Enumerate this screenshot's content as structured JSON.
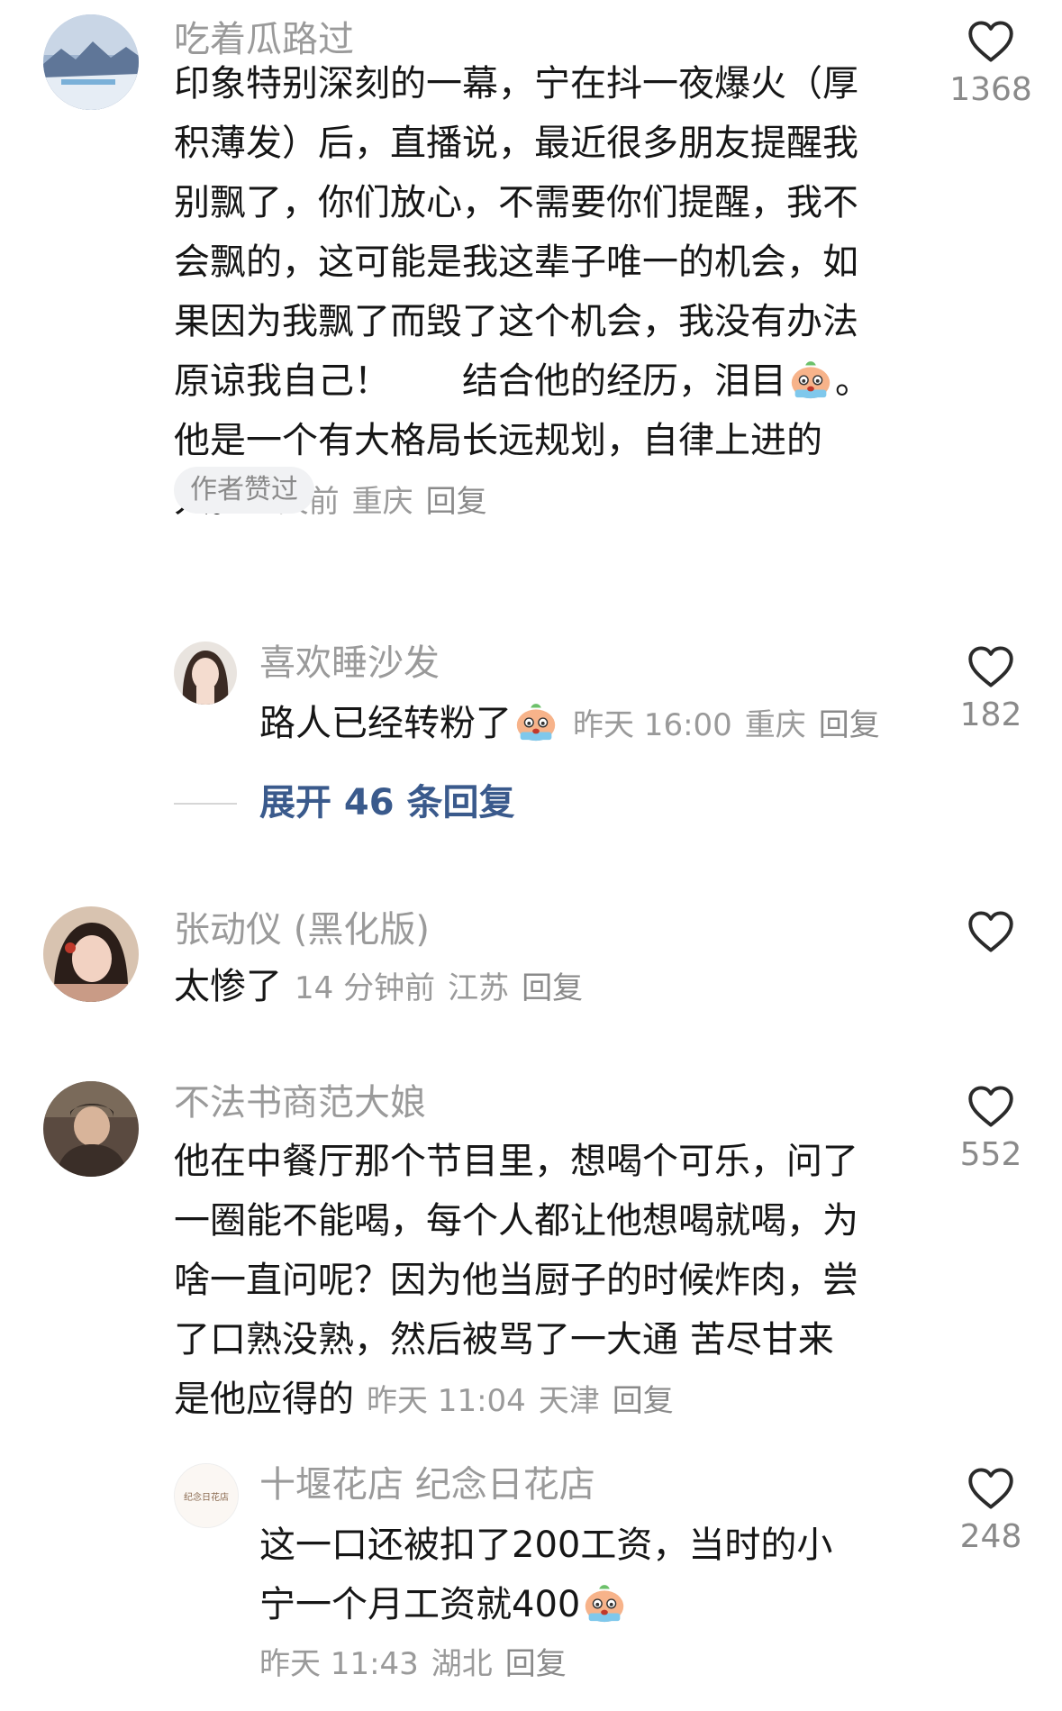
{
  "comments": [
    {
      "username": "吃着瓜路过",
      "lines": [
        "印象特别深刻的一幕，宁在抖一夜爆火（厚",
        "积薄发）后，直播说，最近很多朋友提醒我",
        "别飘了，你们放心，不需要你们提醒，我不",
        "会飘的，这可能是我这辈子唯一的机会，如",
        "果因为我飘了而毁了这个机会，我没有办法",
        "原谅我自己！　　结合他的经历，泪目",
        "他是一个有大格局长远规划，自律上进的",
        "人。"
      ],
      "line6_tail": "。",
      "time": "1天前",
      "location": "重庆",
      "reply": "回复",
      "badge": "作者赞过",
      "likes": "1368",
      "reply_item": {
        "username": "喜欢睡沙发",
        "text": "路人已经转粉了",
        "time": "昨天 16:00",
        "location": "重庆",
        "reply": "回复",
        "likes": "182"
      },
      "expand_label": "展开 46 条回复"
    },
    {
      "username": "张动仪 (黑化版)",
      "text": "太惨了",
      "time": "14 分钟前",
      "location": "江苏",
      "reply": "回复"
    },
    {
      "username": "不法书商范大娘",
      "lines": [
        "他在中餐厅那个节目里，想喝个可乐，问了",
        "一圈能不能喝，每个人都让他想喝就喝，为",
        "啥一直问呢？因为他当厨子的时候炸肉，尝",
        "了口熟没熟，然后被骂了一大通 苦尽甘来",
        "是他应得的"
      ],
      "time": "昨天 11:04",
      "location": "天津",
      "reply": "回复",
      "likes": "552",
      "reply_item": {
        "username": "十堰花店 纪念日花店",
        "lines": [
          "这一口还被扣了200工资，当时的小",
          "宁一个月工资就400"
        ],
        "time": "昨天 11:43",
        "location": "湖北",
        "reply": "回复",
        "likes": "248",
        "avatar_text": "纪念日花店"
      }
    }
  ],
  "icons": {
    "like": "heart-outline-icon",
    "emoji": "crying-emoji-icon"
  },
  "colors": {
    "username": "#9a9a9a",
    "meta": "#9a9a9a",
    "expand_link": "#3a5a8c",
    "badge_bg": "#f1f2f4"
  }
}
